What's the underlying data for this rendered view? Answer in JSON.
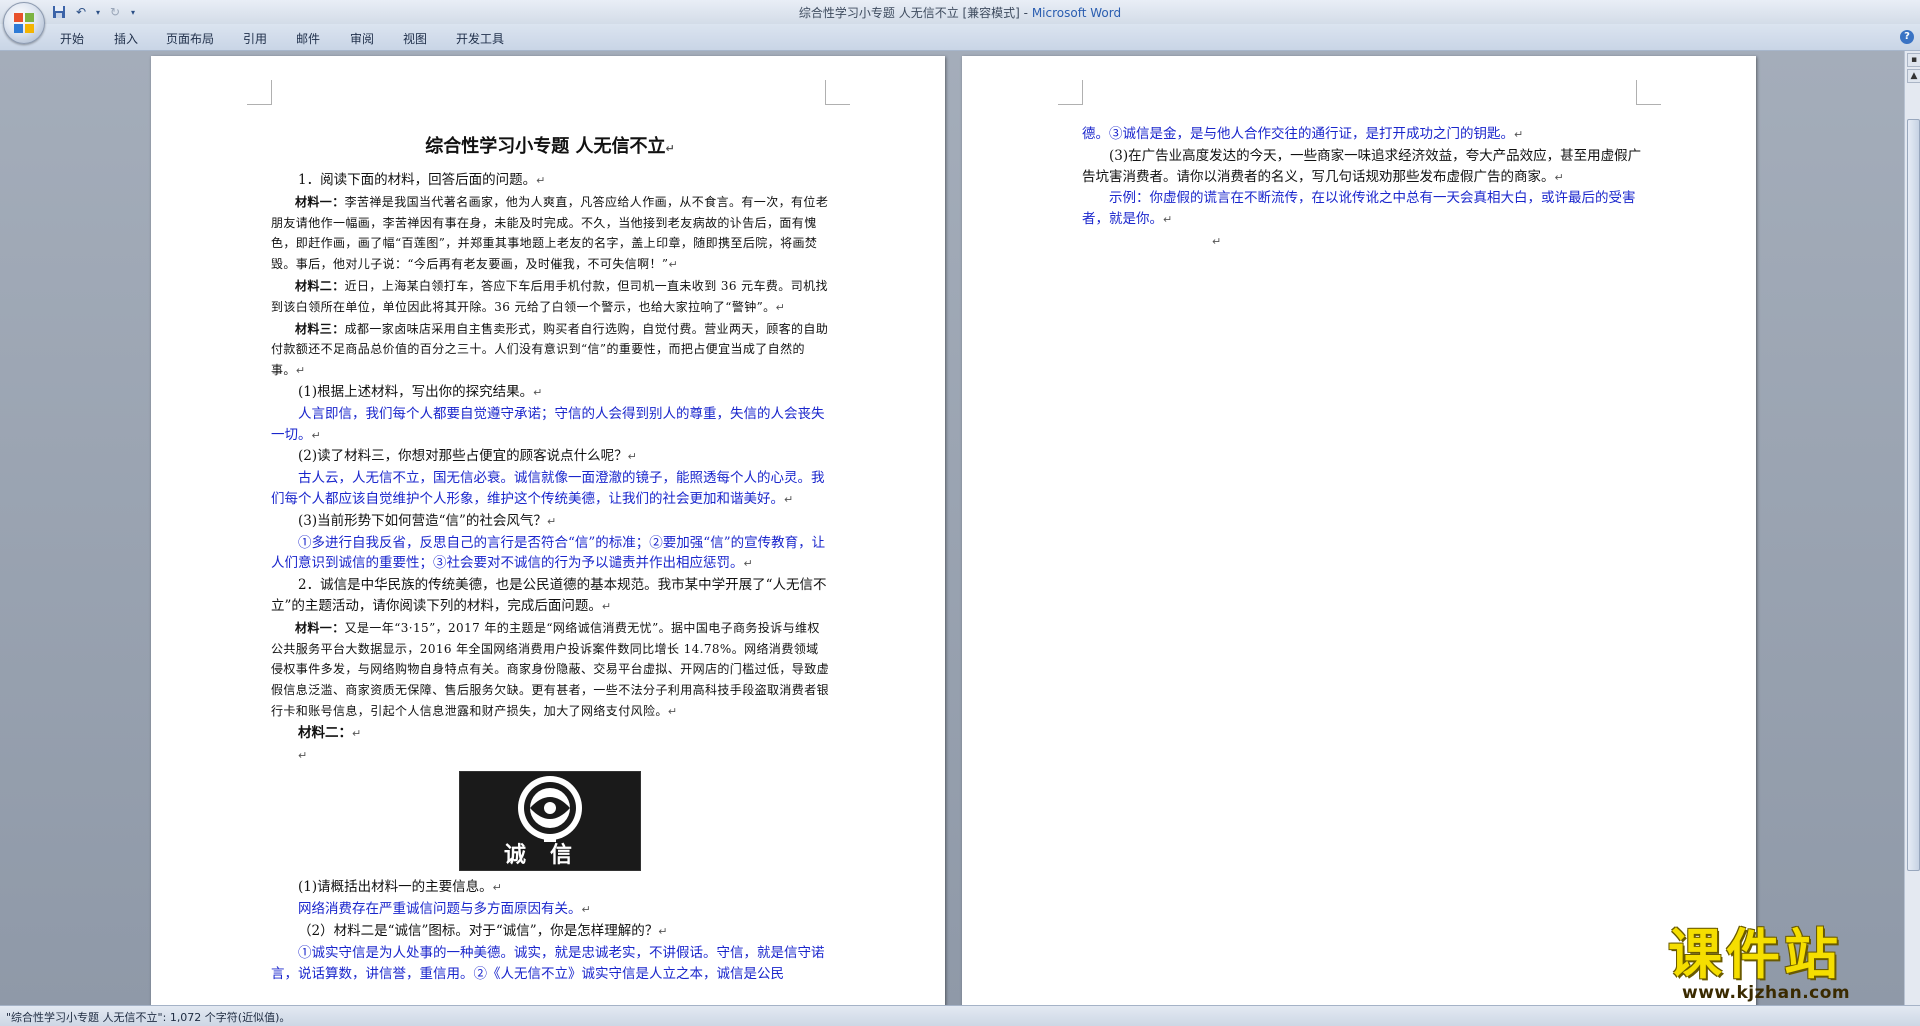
{
  "window": {
    "title_doc": "综合性学习小专题   人无信不立 [兼容模式] - ",
    "title_app": "Microsoft Word"
  },
  "ribbon": {
    "tabs": [
      "开始",
      "插入",
      "页面布局",
      "引用",
      "邮件",
      "审阅",
      "视图",
      "开发工具"
    ]
  },
  "page1": {
    "title": "综合性学习小专题    人无信不立",
    "q1_intro": "1．阅读下面的材料，回答后面的问题。",
    "m1_label": "材料一：",
    "m1_text": "李苦禅是我国当代著名画家，他为人爽直，凡答应给人作画，从不食言。有一次，有位老朋友请他作一幅画，李苦禅因有事在身，未能及时完成。不久，当他接到老友病故的讣告后，面有愧色，即赶作画，画了幅“百莲图”，并郑重其事地题上老友的名字，盖上印章，随即携至后院，将画焚毁。事后，他对儿子说：“今后再有老友要画，及时催我，不可失信啊！”",
    "m2_label": "材料二：",
    "m2_text": "近日，上海某白领打车，答应下车后用手机付款，但司机一直未收到 36 元车费。司机找到该白领所在单位，单位因此将其开除。36 元给了白领一个警示，也给大家拉响了“警钟”。",
    "m3_label": "材料三：",
    "m3_text": "成都一家卤味店采用自主售卖形式，购买者自行选购，自觉付费。营业两天，顾客的自助付款额还不足商品总价值的百分之三十。人们没有意识到“信”的重要性，而把占便宜当成了自然的事。",
    "q1_1": "(1)根据上述材料，写出你的探究结果。",
    "a1_1": "人言即信，我们每个人都要自觉遵守承诺；守信的人会得到别人的尊重，失信的人会丧失一切。",
    "q1_2": "(2)读了材料三，你想对那些占便宜的顾客说点什么呢？",
    "a1_2": "古人云，人无信不立，国无信必衰。诚信就像一面澄澈的镜子，能照透每个人的心灵。我们每个人都应该自觉维护个人形象，维护这个传统美德，让我们的社会更加和谐美好。",
    "q1_3": "(3)当前形势下如何营造“信”的社会风气？",
    "a1_3": "①多进行自我反省，反思自己的言行是否符合“信”的标准；②要加强“信”的宣传教育，让人们意识到诚信的重要性；③社会要对不诚信的行为予以谴责并作出相应惩罚。",
    "q2_intro": "2．诚信是中华民族的传统美德，也是公民道德的基本规范。我市某中学开展了“人无信不立”的主题活动，请你阅读下列的材料，完成后面问题。",
    "m21_label": "材料一：",
    "m21_text": "又是一年“3·15”，2017 年的主题是“网络诚信消费无忧”。据中国电子商务投诉与维权公共服务平台大数据显示，2016 年全国网络消费用户投诉案件数同比增长 14.78%。网络消费领域侵权事件多发，与网络购物自身特点有关。商家身份隐蔽、交易平台虚拟、开网店的门槛过低，导致虚假信息泛滥、商家资质无保障、售后服务欠缺。更有甚者，一些不法分子利用高科技手段盗取消费者银行卡和账号信息，引起个人信息泄露和财产损失，加大了网络支付风险。",
    "m22_label": "材料二：",
    "logo_text": "诚信",
    "q2_1": "(1)请概括出材料一的主要信息。",
    "a2_1": "网络消费存在严重诚信问题与多方面原因有关。",
    "q2_2": "（2）材料二是“诚信”图标。对于“诚信”，你是怎样理解的？",
    "a2_2": "①诚实守信是为人处事的一种美德。诚实，就是忠诚老实，不讲假话。守信，就是信守诺言，说话算数，讲信誉，重信用。②《人无信不立》诚实守信是人立之本，诚信是公民"
  },
  "page2": {
    "a2_2_cont": "德。③诚信是金，是与他人合作交往的通行证，是打开成功之门的钥匙。",
    "q2_3": "(3)在广告业高度发达的今天，一些商家一味追求经济效益，夸大产品效应，甚至用虚假广告坑害消费者。请你以消费者的名义，写几句话规劝那些发布虚假广告的商家。",
    "a2_3": "示例：你虚假的谎言在不断流传，在以讹传讹之中总有一天会真相大白，或许最后的受害者，就是你。"
  },
  "marks": {
    "para": "↵"
  },
  "status": {
    "text": "\"综合性学习小专题   人无信不立\": 1,072 个字符(近似值)。"
  },
  "watermark": {
    "title": "课件站",
    "url": "www.kjzhan.com"
  }
}
